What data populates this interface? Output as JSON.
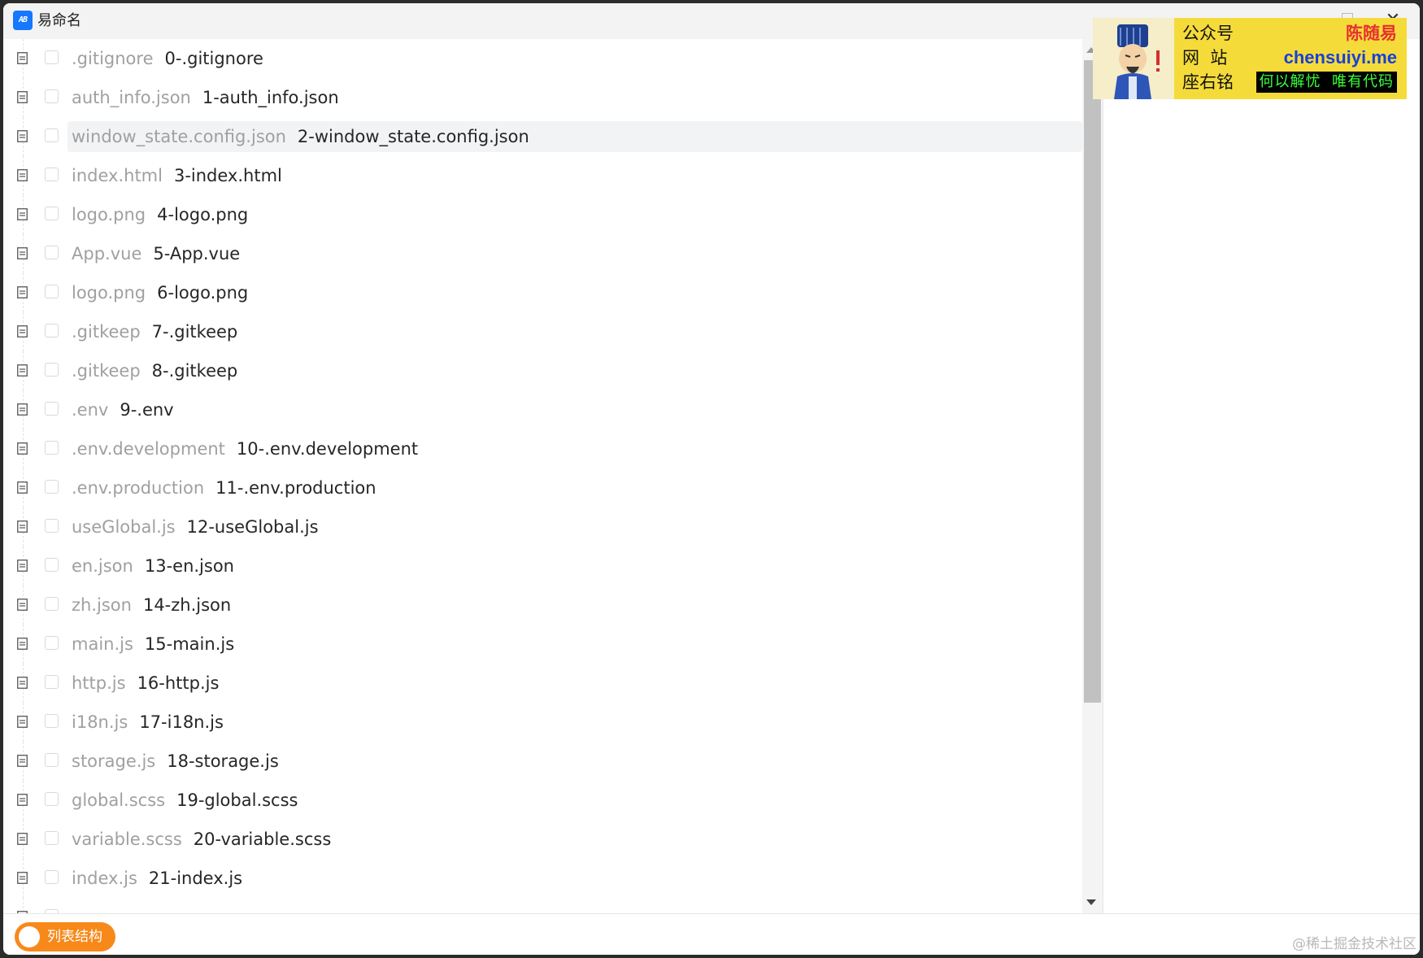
{
  "window": {
    "app_icon_text": "AB",
    "title": "易命名",
    "maximize_icon": "maximize-icon",
    "close_glyph": "✕"
  },
  "files": [
    {
      "old": ".gitignore",
      "new": "0-.gitignore"
    },
    {
      "old": "auth_info.json",
      "new": "1-auth_info.json"
    },
    {
      "old": "window_state.config.json",
      "new": "2-window_state.config.json",
      "selected": true
    },
    {
      "old": "index.html",
      "new": "3-index.html"
    },
    {
      "old": "logo.png",
      "new": "4-logo.png"
    },
    {
      "old": "App.vue",
      "new": "5-App.vue"
    },
    {
      "old": "logo.png",
      "new": "6-logo.png"
    },
    {
      "old": ".gitkeep",
      "new": "7-.gitkeep"
    },
    {
      "old": ".gitkeep",
      "new": "8-.gitkeep"
    },
    {
      "old": ".env",
      "new": "9-.env"
    },
    {
      "old": ".env.development",
      "new": "10-.env.development"
    },
    {
      "old": ".env.production",
      "new": "11-.env.production"
    },
    {
      "old": "useGlobal.js",
      "new": "12-useGlobal.js"
    },
    {
      "old": "en.json",
      "new": "13-en.json"
    },
    {
      "old": "zh.json",
      "new": "14-zh.json"
    },
    {
      "old": "main.js",
      "new": "15-main.js"
    },
    {
      "old": "http.js",
      "new": "16-http.js"
    },
    {
      "old": "i18n.js",
      "new": "17-i18n.js"
    },
    {
      "old": "storage.js",
      "new": "18-storage.js"
    },
    {
      "old": "global.scss",
      "new": "19-global.scss"
    },
    {
      "old": "variable.scss",
      "new": "20-variable.scss"
    },
    {
      "old": "index.js",
      "new": "21-index.js"
    }
  ],
  "ad": {
    "line1": "公众号",
    "line2": "网  站",
    "line3": "座右铭",
    "author": "陈随易",
    "site": "chensuiyi.me",
    "motto": "何以解忧  唯有代码",
    "avatar_icon": "cartoon-scholar-avatar"
  },
  "footer": {
    "toggle_label": "列表结构",
    "toggle_on": true,
    "watermark": "@稀土掘金技术社区"
  },
  "colors": {
    "accent_orange": "#f7891b",
    "selected_row_bg": "#f2f3f5",
    "old_name_text": "#a0a0a0",
    "new_name_text": "#262626",
    "ad_yellow": "#f5db3a",
    "ad_red": "#e53030",
    "ad_blue": "#1a3fd6",
    "ad_green": "#39ff39"
  }
}
